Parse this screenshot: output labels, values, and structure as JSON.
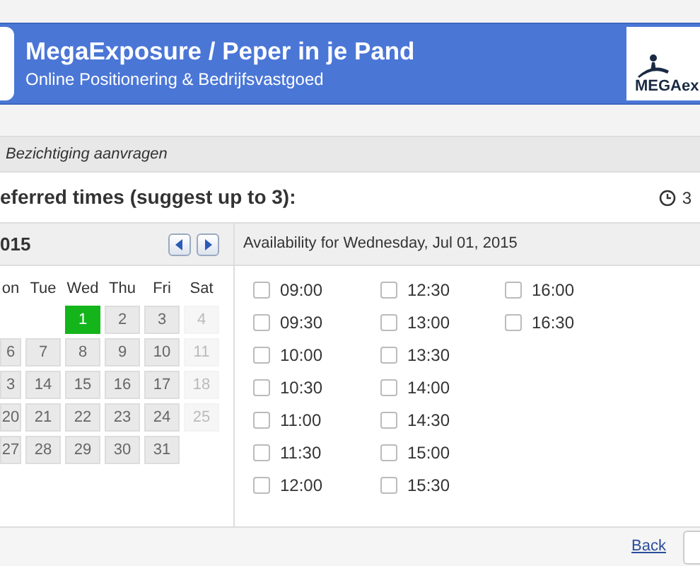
{
  "header": {
    "title": "MegaExposure / Peper in je Pand",
    "subtitle": "Online Positionering & Bedrijfsvastgoed",
    "logo_text": "MEGAex"
  },
  "breadcrumb": "Bezichtiging aanvragen",
  "heading": "eferred times (suggest up to 3):",
  "duration": "3",
  "calendar": {
    "month": "015",
    "weekdays": [
      "on",
      "Tue",
      "Wed",
      "Thu",
      "Fri",
      "Sat"
    ],
    "weeks": [
      [
        {
          "kind": "blank"
        },
        {
          "kind": "blank"
        },
        {
          "kind": "day",
          "label": "1",
          "selected": true,
          "disabled": false
        },
        {
          "kind": "day",
          "label": "2",
          "selected": false,
          "disabled": false
        },
        {
          "kind": "day",
          "label": "3",
          "selected": false,
          "disabled": false
        },
        {
          "kind": "day",
          "label": "4",
          "selected": false,
          "disabled": true
        }
      ],
      [
        {
          "kind": "day",
          "label": "6",
          "selected": false,
          "disabled": false
        },
        {
          "kind": "day",
          "label": "7",
          "selected": false,
          "disabled": false
        },
        {
          "kind": "day",
          "label": "8",
          "selected": false,
          "disabled": false
        },
        {
          "kind": "day",
          "label": "9",
          "selected": false,
          "disabled": false
        },
        {
          "kind": "day",
          "label": "10",
          "selected": false,
          "disabled": false
        },
        {
          "kind": "day",
          "label": "11",
          "selected": false,
          "disabled": true
        }
      ],
      [
        {
          "kind": "day",
          "label": "3",
          "selected": false,
          "disabled": false
        },
        {
          "kind": "day",
          "label": "14",
          "selected": false,
          "disabled": false
        },
        {
          "kind": "day",
          "label": "15",
          "selected": false,
          "disabled": false
        },
        {
          "kind": "day",
          "label": "16",
          "selected": false,
          "disabled": false
        },
        {
          "kind": "day",
          "label": "17",
          "selected": false,
          "disabled": false
        },
        {
          "kind": "day",
          "label": "18",
          "selected": false,
          "disabled": true
        }
      ],
      [
        {
          "kind": "day",
          "label": "20",
          "selected": false,
          "disabled": false
        },
        {
          "kind": "day",
          "label": "21",
          "selected": false,
          "disabled": false
        },
        {
          "kind": "day",
          "label": "22",
          "selected": false,
          "disabled": false
        },
        {
          "kind": "day",
          "label": "23",
          "selected": false,
          "disabled": false
        },
        {
          "kind": "day",
          "label": "24",
          "selected": false,
          "disabled": false
        },
        {
          "kind": "day",
          "label": "25",
          "selected": false,
          "disabled": true
        }
      ],
      [
        {
          "kind": "day",
          "label": "27",
          "selected": false,
          "disabled": false
        },
        {
          "kind": "day",
          "label": "28",
          "selected": false,
          "disabled": false
        },
        {
          "kind": "day",
          "label": "29",
          "selected": false,
          "disabled": false
        },
        {
          "kind": "day",
          "label": "30",
          "selected": false,
          "disabled": false
        },
        {
          "kind": "day",
          "label": "31",
          "selected": false,
          "disabled": false
        },
        {
          "kind": "blank"
        }
      ]
    ]
  },
  "availability": {
    "title": "Availability for Wednesday, Jul 01, 2015",
    "slots": [
      {
        "time": "09:00",
        "checked": false
      },
      {
        "time": "09:30",
        "checked": false
      },
      {
        "time": "10:00",
        "checked": false
      },
      {
        "time": "10:30",
        "checked": false
      },
      {
        "time": "11:00",
        "checked": false
      },
      {
        "time": "11:30",
        "checked": false
      },
      {
        "time": "12:00",
        "checked": false
      },
      {
        "time": "12:30",
        "checked": false
      },
      {
        "time": "13:00",
        "checked": false
      },
      {
        "time": "13:30",
        "checked": false
      },
      {
        "time": "14:00",
        "checked": false
      },
      {
        "time": "14:30",
        "checked": false
      },
      {
        "time": "15:00",
        "checked": false
      },
      {
        "time": "15:30",
        "checked": false
      },
      {
        "time": "16:00",
        "checked": false
      },
      {
        "time": "16:30",
        "checked": false
      }
    ]
  },
  "footer": {
    "back_link": "Back"
  }
}
